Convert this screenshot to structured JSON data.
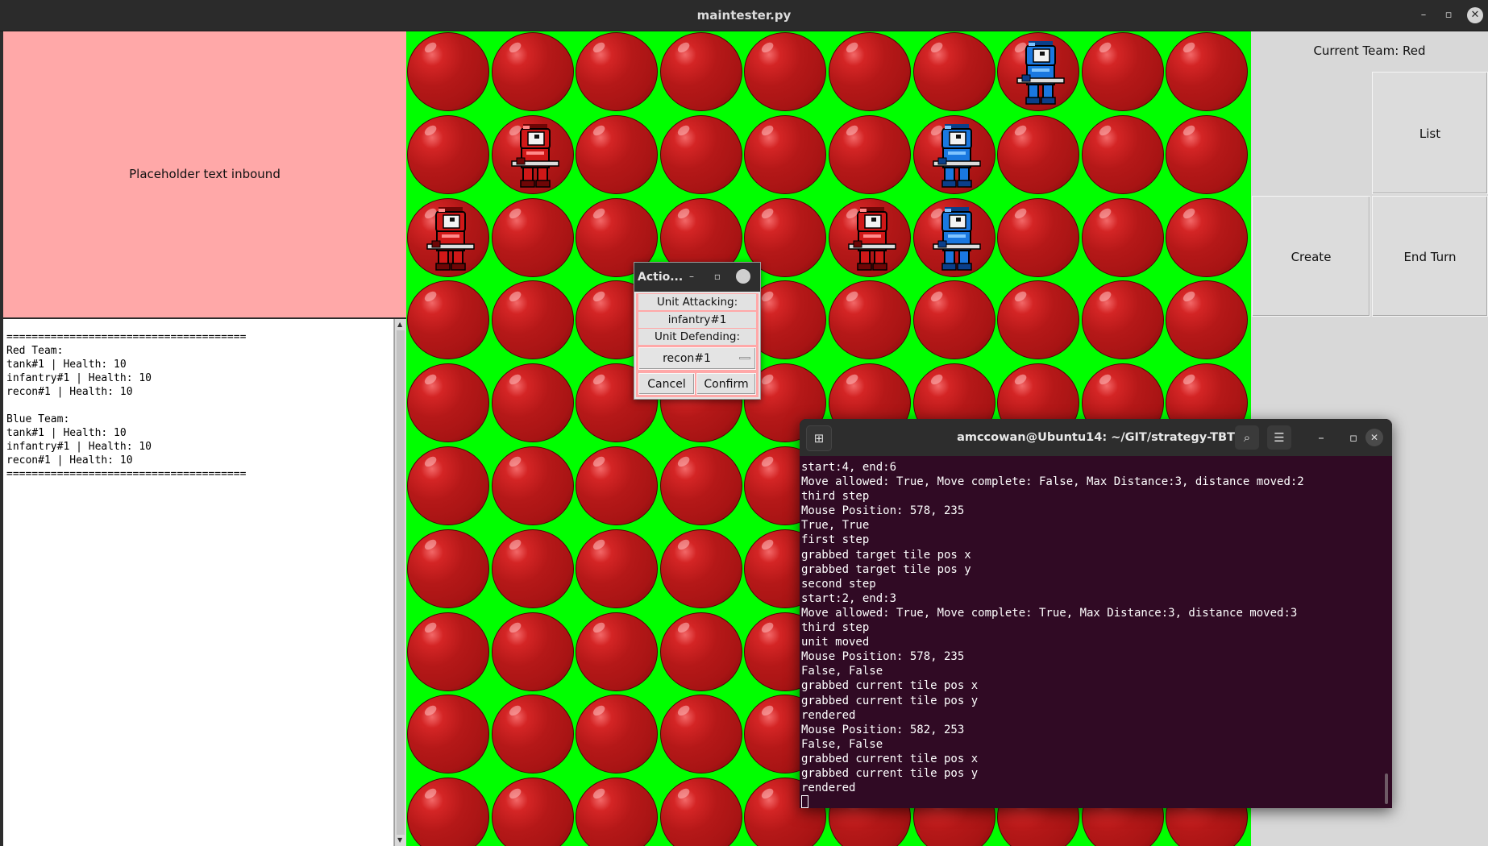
{
  "window": {
    "title": "maintester.py",
    "controls": {
      "minimize": "–",
      "restore": "▫",
      "close": "✕"
    }
  },
  "left_panel": {
    "placeholder": "Placeholder text inbound",
    "status_text": "======================================\nRed Team:\ntank#1 | Health: 10\ninfantry#1 | Health: 10\nrecon#1 | Health: 10\n\nBlue Team:\ntank#1 | Health: 10\ninfantry#1 | Health: 10\nrecon#1 | Health: 10\n======================================"
  },
  "board": {
    "rows": 10,
    "cols": 10,
    "background": "#00ff00",
    "tile_color": "#b51818",
    "units": [
      {
        "team": "blue",
        "row": 0,
        "col": 7
      },
      {
        "team": "red",
        "row": 1,
        "col": 1
      },
      {
        "team": "blue",
        "row": 1,
        "col": 6
      },
      {
        "team": "red",
        "row": 2,
        "col": 0
      },
      {
        "team": "red",
        "row": 2,
        "col": 5
      },
      {
        "team": "blue",
        "row": 2,
        "col": 6
      }
    ]
  },
  "right_panel": {
    "current_team": "Current Team: Red",
    "buttons": {
      "list": "List",
      "create": "Create",
      "end_turn": "End Turn"
    }
  },
  "dialog": {
    "title": "Actio...",
    "unit_attacking_label": "Unit Attacking:",
    "unit_attacking": "infantry#1",
    "unit_defending_label": "Unit Defending:",
    "selected_defender": "recon#1",
    "cancel": "Cancel",
    "confirm": "Confirm"
  },
  "terminal": {
    "title": "amccowan@Ubuntu14: ~/GIT/strategy-TBT",
    "output": "start:4, end:6\nMove allowed: True, Move complete: False, Max Distance:3, distance moved:2\nthird step\nMouse Position: 578, 235\nTrue, True\nfirst step\ngrabbed target tile pos x\ngrabbed target tile pos y\nsecond step\nstart:2, end:3\nMove allowed: True, Move complete: True, Max Distance:3, distance moved:3\nthird step\nunit moved\nMouse Position: 578, 235\nFalse, False\ngrabbed current tile pos x\ngrabbed current tile pos y\nrendered\nMouse Position: 582, 253\nFalse, False\ngrabbed current tile pos x\ngrabbed current tile pos y\nrendered"
  },
  "colors": {
    "placeholder_bg": "#ffa8a8",
    "board_bg": "#00ff00",
    "terminal_bg": "#300a24",
    "red_team": "#d01818",
    "blue_team": "#1a78e0"
  }
}
